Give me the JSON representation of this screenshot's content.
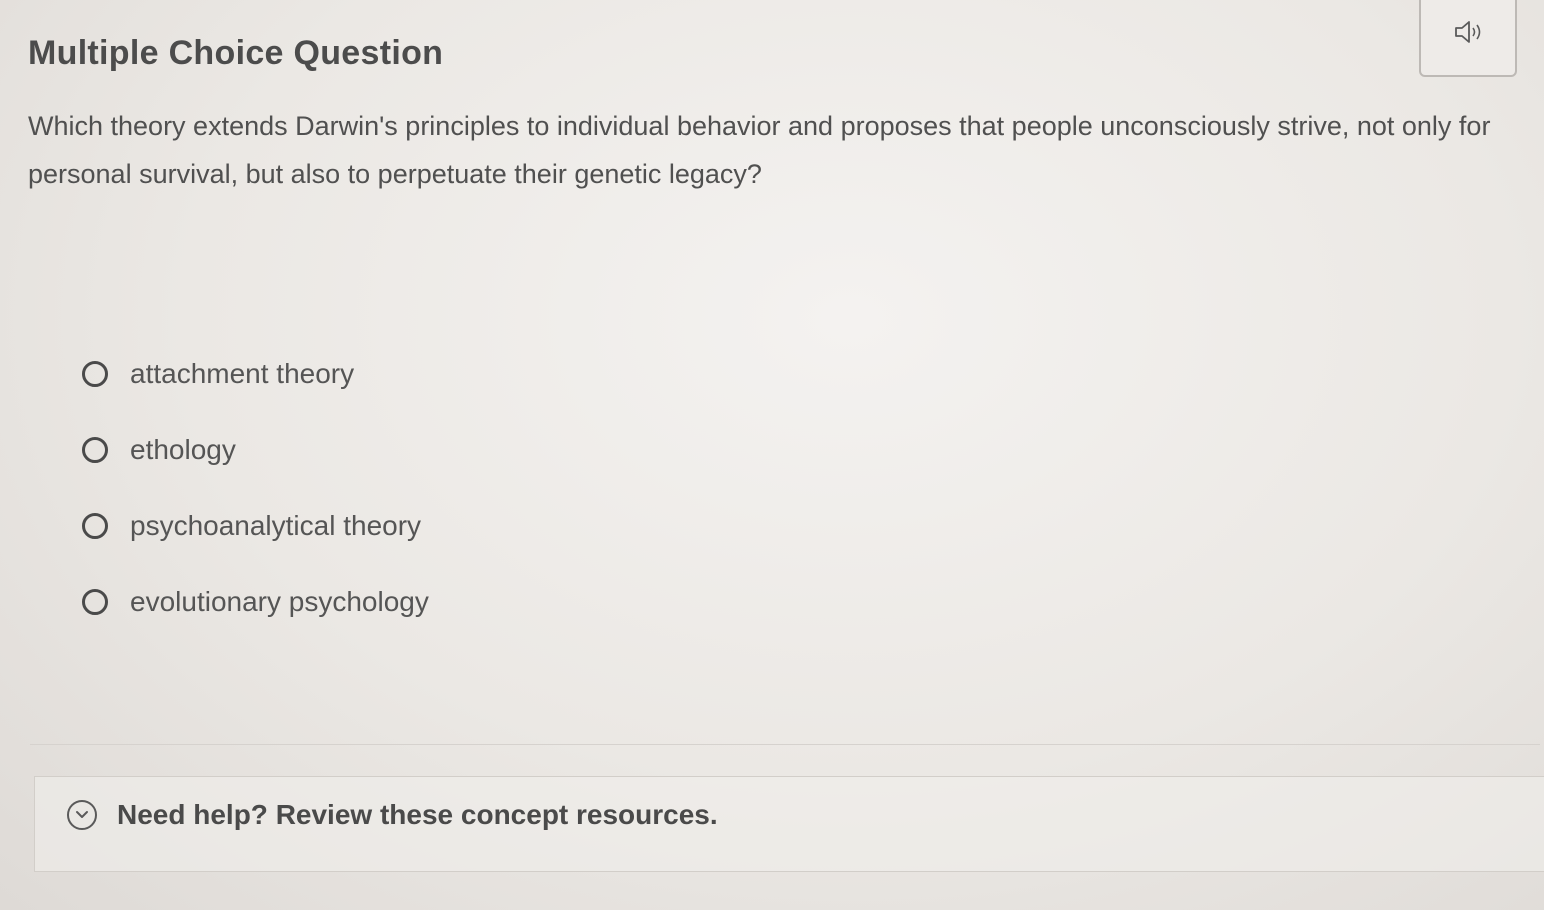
{
  "header": {
    "title": "Multiple Choice Question",
    "audio_icon": "speaker-icon"
  },
  "question": {
    "text": "Which theory extends Darwin's principles to individual behavior and proposes that people unconsciously strive, not only for personal survival, but also to perpetuate their genetic legacy?"
  },
  "options": [
    {
      "label": "attachment theory",
      "selected": false
    },
    {
      "label": "ethology",
      "selected": false
    },
    {
      "label": "psychoanalytical theory",
      "selected": false
    },
    {
      "label": "evolutionary psychology",
      "selected": false
    }
  ],
  "help": {
    "label": "Need help? Review these concept resources.",
    "icon": "chevron-down-icon"
  }
}
